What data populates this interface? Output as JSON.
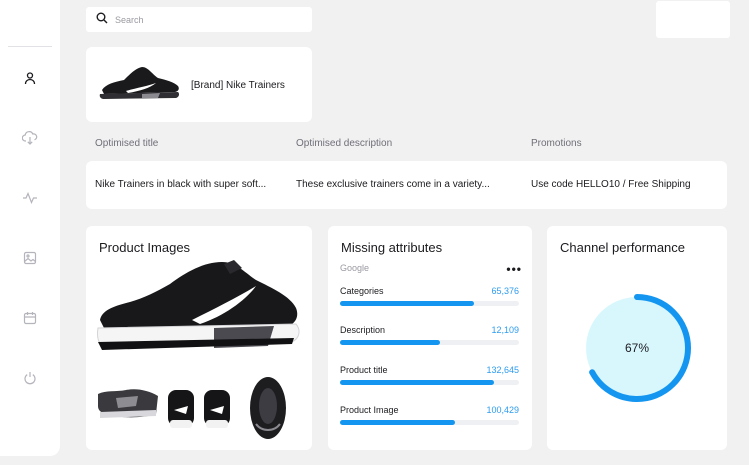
{
  "search": {
    "placeholder": "Search"
  },
  "product": {
    "name": "[Brand] Nike Trainers"
  },
  "optimised": {
    "headers": [
      "Optimised title",
      "Optimised description",
      "Promotions"
    ],
    "values": [
      "Nike Trainers in black with super soft...",
      "These exclusive trainers come in a variety...",
      "Use code HELLO10 / Free Shipping"
    ]
  },
  "product_images": {
    "title": "Product Images"
  },
  "missing_attributes": {
    "title": "Missing attributes",
    "source": "Google",
    "items": [
      {
        "label": "Categories",
        "count": "65,376",
        "fill": 0.75
      },
      {
        "label": "Description",
        "count": "12,109",
        "fill": 0.56
      },
      {
        "label": "Product title",
        "count": "132,645",
        "fill": 0.86
      },
      {
        "label": "Product Image",
        "count": "100,429",
        "fill": 0.64
      }
    ]
  },
  "channel_performance": {
    "title": "Channel performance",
    "percent": 67,
    "percent_label": "67%"
  },
  "colors": {
    "accent": "#1496f0",
    "gauge_fill": "#d8f7fd",
    "bg": "#f1f1f2"
  },
  "icons": [
    "user-icon",
    "cloud-download-icon",
    "activity-icon",
    "image-icon",
    "calendar-icon",
    "power-icon",
    "search-icon",
    "more-icon"
  ]
}
